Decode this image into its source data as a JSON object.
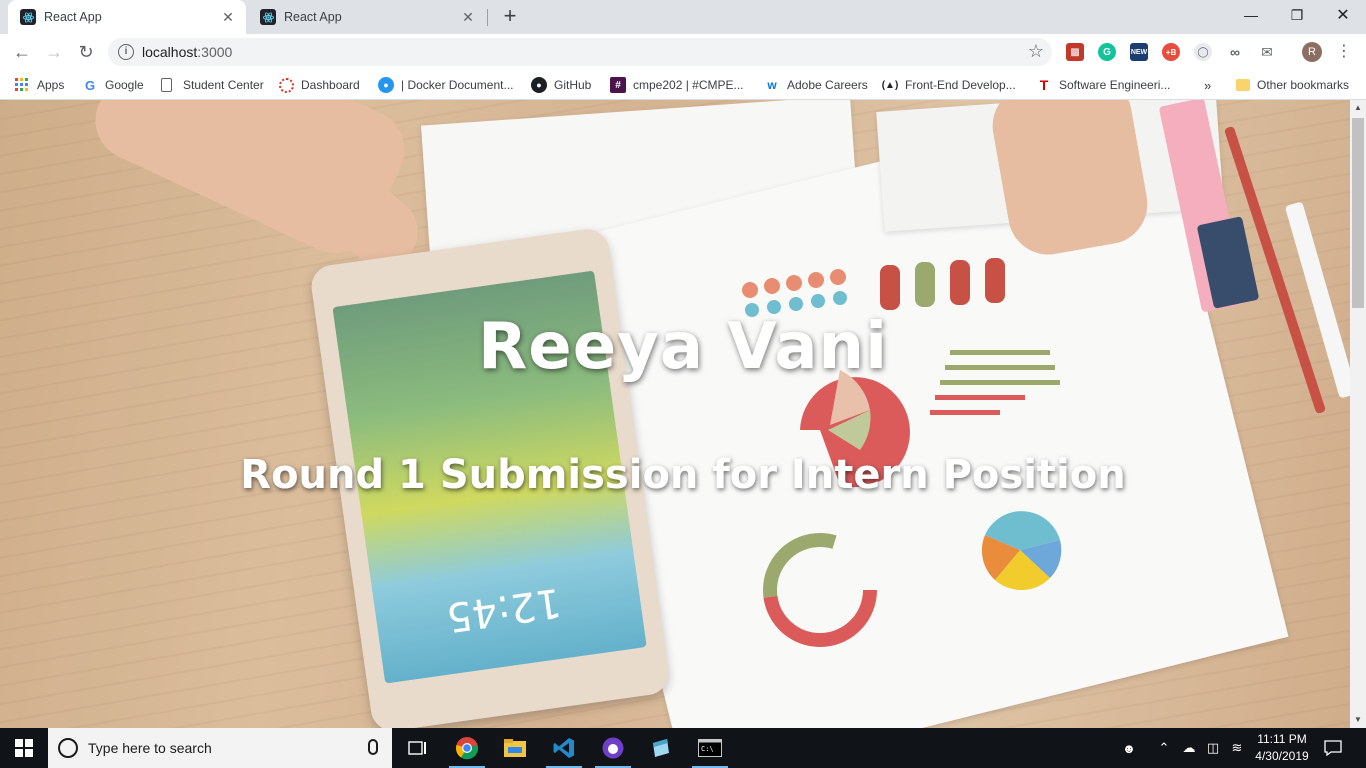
{
  "browser": {
    "tabs": [
      {
        "title": "React App",
        "active": true
      },
      {
        "title": "React App",
        "active": false
      }
    ],
    "new_tab_label": "+",
    "url_host": "localhost",
    "url_port": ":3000",
    "bookmarks": [
      {
        "label": "Apps",
        "icon": "apps-grid-icon"
      },
      {
        "label": "Google",
        "icon": "google-icon"
      },
      {
        "label": "Student Center",
        "icon": "page-icon"
      },
      {
        "label": "Dashboard",
        "icon": "dashboard-icon"
      },
      {
        "label": "| Docker Document...",
        "icon": "docker-icon"
      },
      {
        "label": "GitHub",
        "icon": "github-icon"
      },
      {
        "label": "cmpe202 | #CMPE...",
        "icon": "slack-icon"
      },
      {
        "label": "Adobe Careers",
        "icon": "workday-icon"
      },
      {
        "label": "Front-End Develop...",
        "icon": "freecodecamp-icon"
      },
      {
        "label": "Software Engineeri...",
        "icon": "tesla-icon"
      },
      {
        "label": "Other bookmarks",
        "icon": "folder-icon"
      }
    ],
    "bookmarks_overflow": "»",
    "profile_initial": "R"
  },
  "hero": {
    "title": "Reeya Vani",
    "subtitle": "Round 1 Submission for Intern Position"
  },
  "tablet_clock": "12:45",
  "taskbar": {
    "search_placeholder": "Type here to search",
    "time": "11:11 PM",
    "date": "4/30/2019"
  },
  "colors": {
    "tabstrip": "#dee1e6",
    "taskbar": "#101318",
    "accent_blue": "#0078d7"
  }
}
